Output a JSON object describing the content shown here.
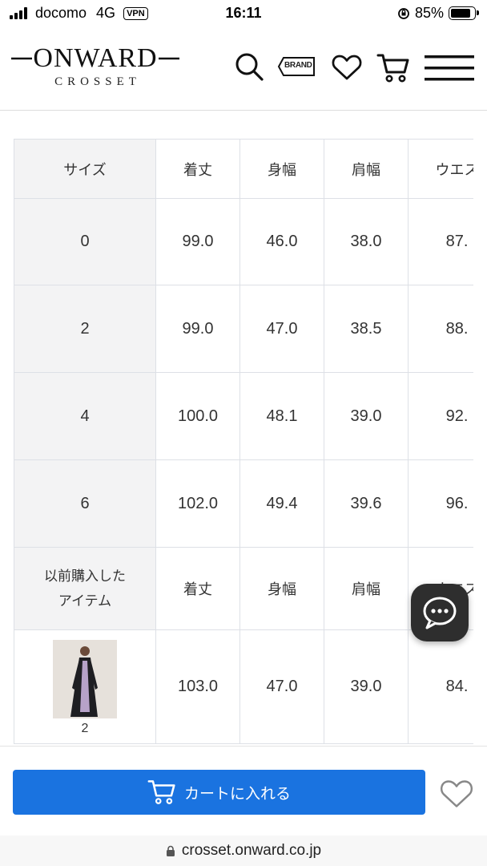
{
  "status_bar": {
    "carrier": "docomo",
    "network": "4G",
    "vpn": "VPN",
    "time": "16:11",
    "battery": "85%",
    "battery_level": 0.85
  },
  "header": {
    "logo_main": "ONWARD",
    "logo_sub": "CROSSET",
    "brand_label": "BRAND",
    "icons": [
      "search-icon",
      "brand-icon",
      "heart-icon",
      "cart-icon",
      "menu-icon"
    ]
  },
  "size_table": {
    "headers": [
      "サイズ",
      "着丈",
      "身幅",
      "肩幅",
      "ウエス"
    ],
    "rows": [
      [
        "0",
        "99.0",
        "46.0",
        "38.0",
        "87."
      ],
      [
        "2",
        "99.0",
        "47.0",
        "38.5",
        "88."
      ],
      [
        "4",
        "100.0",
        "48.1",
        "39.0",
        "92."
      ],
      [
        "6",
        "102.0",
        "49.4",
        "39.6",
        "96."
      ]
    ],
    "previous_headers": [
      "以前購入した",
      "アイテム",
      "着丈",
      "身幅",
      "肩幅",
      "ウエス"
    ],
    "previous_rows": [
      [
        "2",
        "103.0",
        "47.0",
        "39.0",
        "84."
      ]
    ]
  },
  "chat": {
    "icon": "chat-bubble-icon"
  },
  "bottom": {
    "cart_label": "カートに入れる",
    "url": "crosset.onward.co.jp"
  },
  "colors": {
    "accent": "#1a73e0",
    "table_header_bg": "#f3f3f4",
    "table_border": "#dde0e6"
  }
}
